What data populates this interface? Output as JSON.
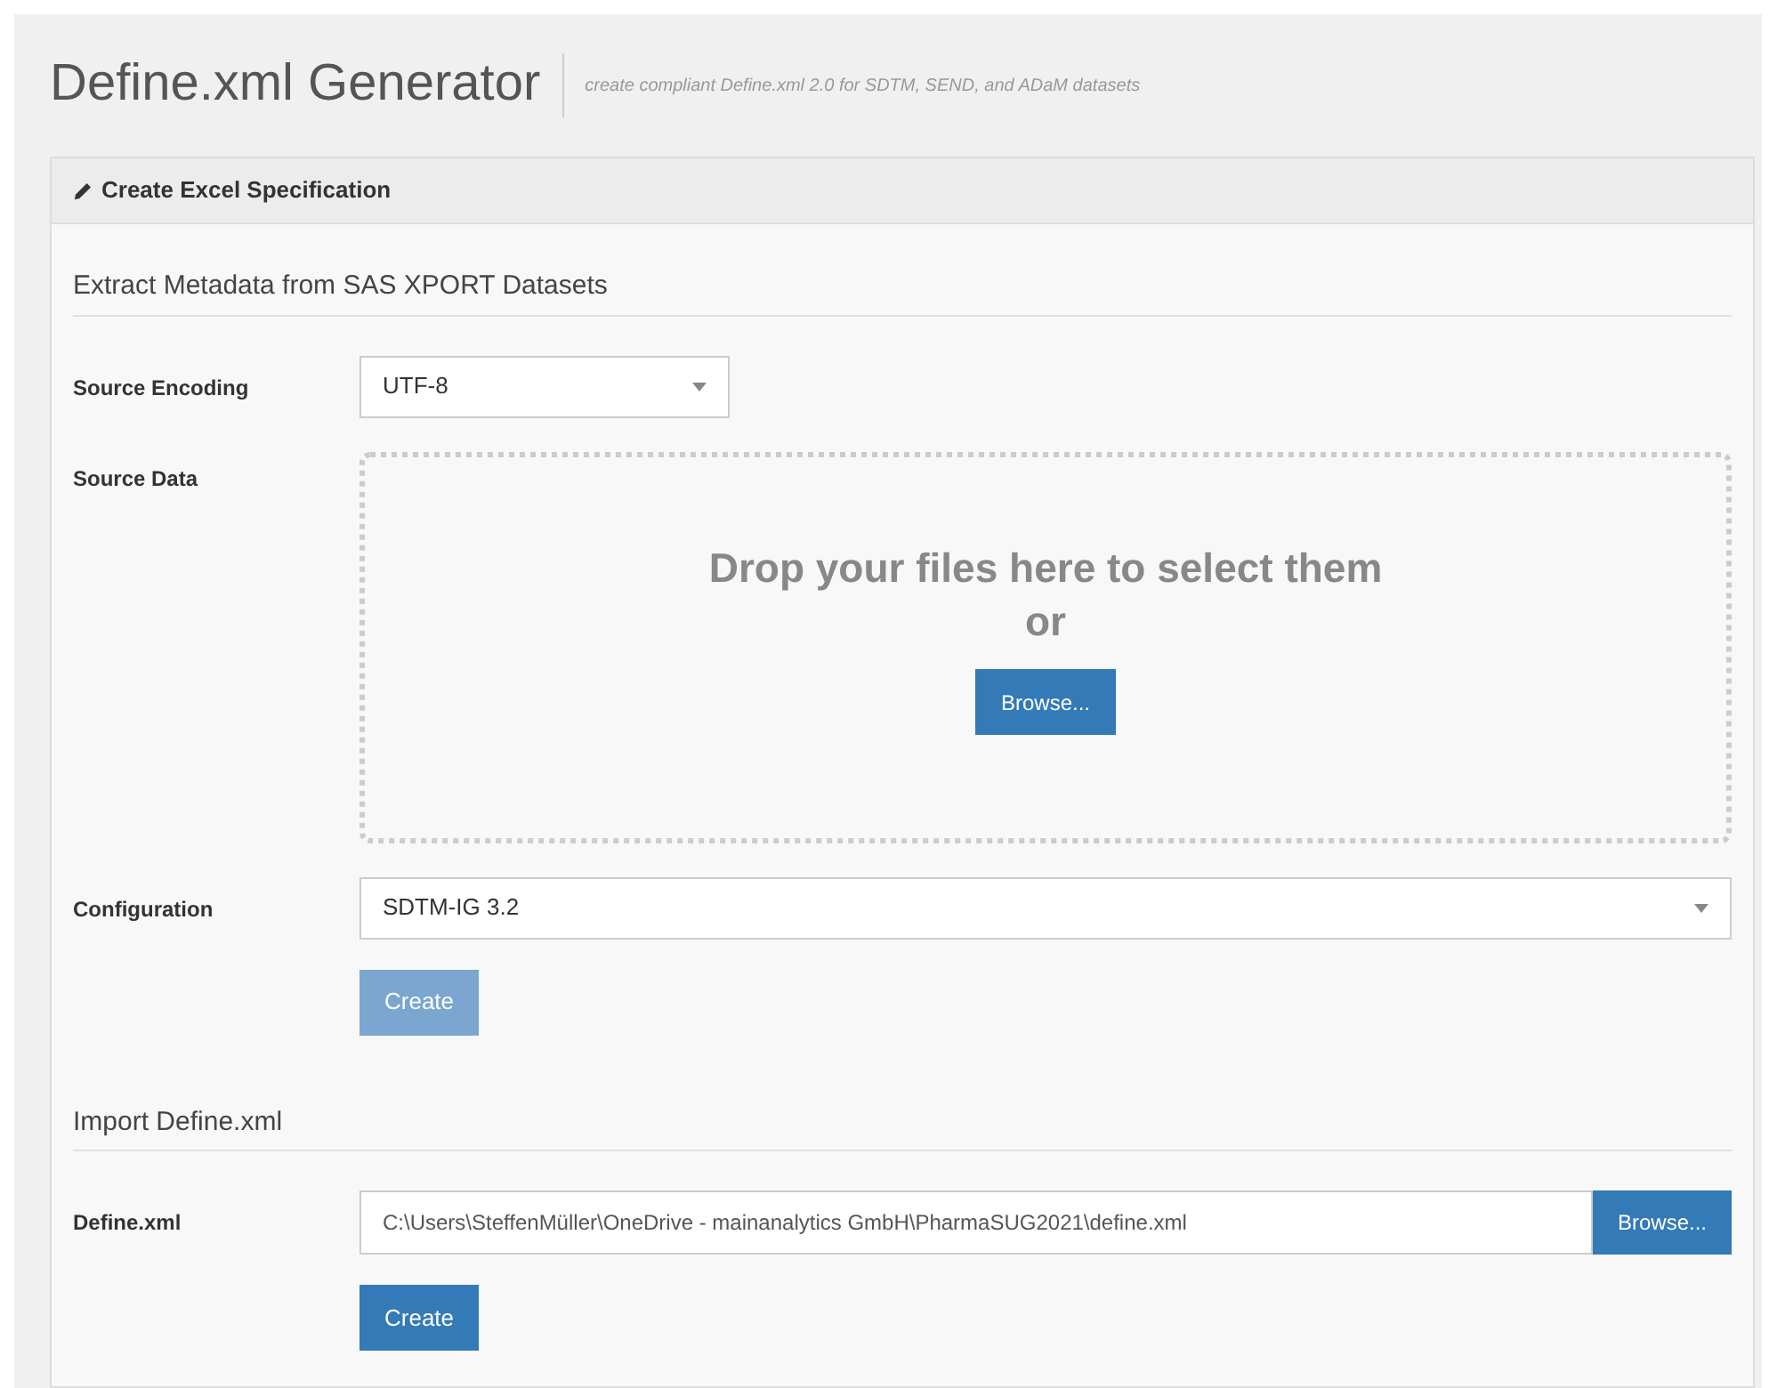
{
  "header": {
    "title": "Define.xml Generator",
    "subtitle": "create compliant Define.xml 2.0 for SDTM, SEND, and ADaM datasets"
  },
  "panel": {
    "title": "Create Excel Specification",
    "sections": [
      {
        "heading": "Extract Metadata from SAS XPORT Datasets",
        "rows": [
          {
            "kind": "select",
            "label": "Source Encoding",
            "value": "UTF-8",
            "wide": false
          },
          {
            "kind": "dropzone",
            "label": "Source Data",
            "text": "Drop your files here to select them",
            "or": "or",
            "button": "Browse..."
          },
          {
            "kind": "select",
            "label": "Configuration",
            "value": "SDTM-IG 3.2",
            "wide": true
          }
        ],
        "action": {
          "label": "Create",
          "disabled": true
        }
      },
      {
        "heading": "Import Define.xml",
        "rows": [
          {
            "kind": "file",
            "label": "Define.xml",
            "value": "C:\\Users\\SteffenMüller\\OneDrive - mainanalytics GmbH\\PharmaSUG2021\\define.xml",
            "button": "Browse..."
          }
        ],
        "action": {
          "label": "Create",
          "disabled": false
        }
      }
    ]
  }
}
